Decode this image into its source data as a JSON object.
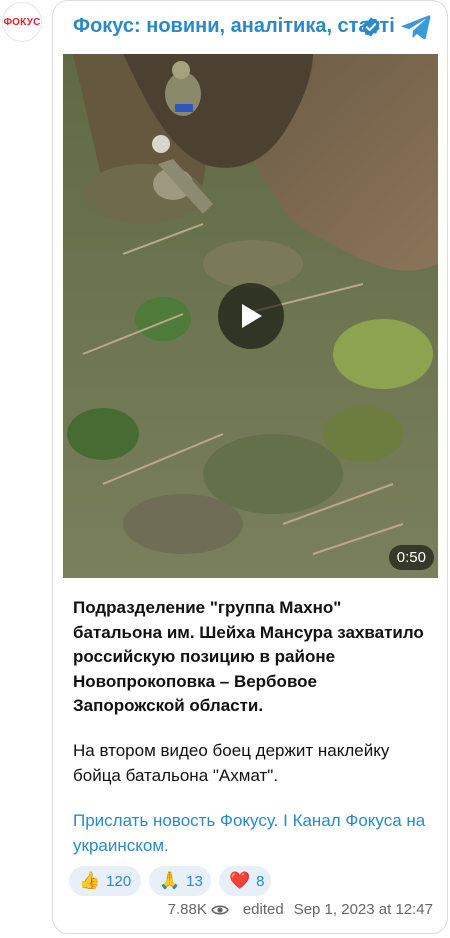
{
  "channel": {
    "avatar_text": "ФОКУС",
    "name": "Фокус: новини, аналітика, статті"
  },
  "video": {
    "duration": "0:50"
  },
  "post": {
    "paragraph1": "Подразделение \"группа Махно\" батальона им. Шейха Мансура захватило российскую позицию в районе Новопрокоповка – Вербовое Запорожской области.",
    "paragraph2": "На втором видео боец держит наклейку бойца батальона \"Ахмат\".",
    "link1": "Прислать новость Фокусу.",
    "separator": " І ",
    "link2": "Канал Фокуса на украинском."
  },
  "reactions": [
    {
      "emoji": "👍",
      "icon": "thumbs-up-icon",
      "count": "120"
    },
    {
      "emoji": "🙏",
      "icon": "folded-hands-icon",
      "count": "13"
    },
    {
      "emoji": "❤️",
      "icon": "heart-icon",
      "count": "8"
    }
  ],
  "footer": {
    "views": "7.88K",
    "edited": "edited",
    "timestamp": "Sep 1, 2023 at 12:47"
  },
  "colors": {
    "accent": "#2a8ac9",
    "brand": "#e4222a"
  }
}
